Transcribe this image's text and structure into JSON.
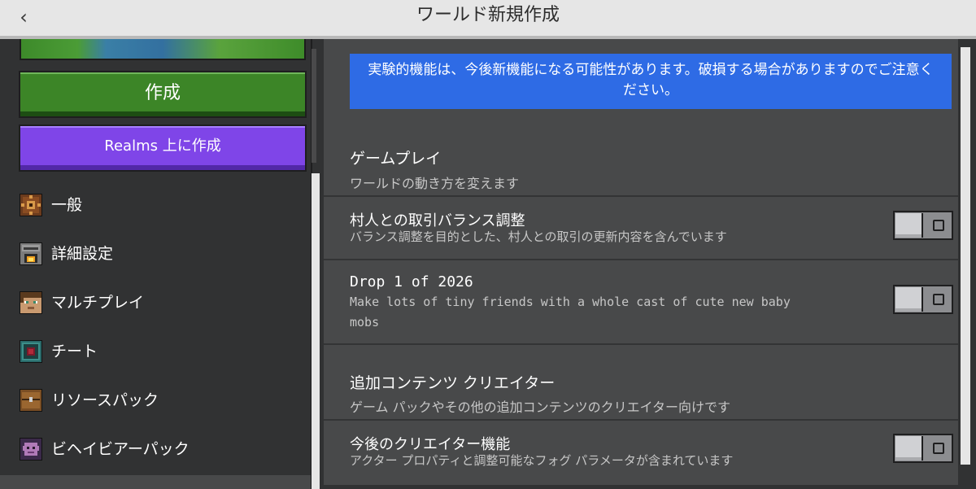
{
  "header": {
    "back_icon": "chevron-left-icon",
    "back_glyph": "‹",
    "title": "ワールド新規作成"
  },
  "sidebar": {
    "create_label": "作成",
    "realms_label": "Realms 上に作成",
    "items": [
      {
        "label": "一般",
        "icon": "gear-icon"
      },
      {
        "label": "詳細設定",
        "icon": "furnace-icon"
      },
      {
        "label": "マルチプレイ",
        "icon": "player-face-icon"
      },
      {
        "label": "チート",
        "icon": "command-block-icon"
      },
      {
        "label": "リソースパック",
        "icon": "chest-icon"
      },
      {
        "label": "ビヘイビアーパック",
        "icon": "creature-icon"
      }
    ]
  },
  "main": {
    "banner": "実験的機能は、今後新機能になる可能性があります。破損する場合がありますのでご注意ください。",
    "sections": [
      {
        "title": "ゲームプレイ",
        "desc": "ワールドの動き方を変えます",
        "settings": [
          {
            "title": "村人との取引バランス調整",
            "desc": "バランス調整を目的とした、村人との取引の更新内容を含んでいます",
            "enabled": false
          },
          {
            "title": "Drop 1 of 2026",
            "desc": "Make lots of tiny friends with a whole cast of cute new baby mobs",
            "enabled": false
          }
        ]
      },
      {
        "title": "追加コンテンツ クリエイター",
        "desc": "ゲーム パックやその他の追加コンテンツのクリエイター向けです",
        "settings": [
          {
            "title": "今後のクリエイター機能",
            "desc": "アクター プロパティと調整可能なフォグ パラメータが含まれています",
            "enabled": false
          }
        ]
      }
    ]
  },
  "colors": {
    "create_green": "#3c8527",
    "realms_purple": "#7f45e8",
    "banner_blue": "#2e6be5",
    "panel_dark": "#313233",
    "panel_main": "#48494a"
  }
}
